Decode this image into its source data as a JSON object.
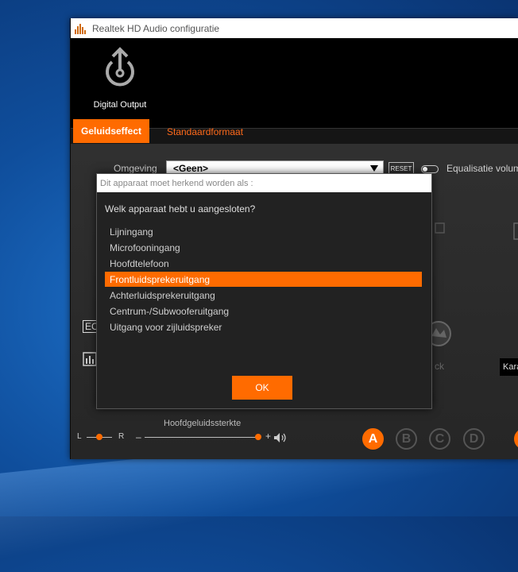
{
  "window": {
    "title": "Realtek HD Audio configuratie"
  },
  "device": {
    "label": "Digital Output"
  },
  "tabs": [
    {
      "label": "Geluidseffect"
    },
    {
      "label": "Standaardformaat"
    }
  ],
  "environment": {
    "label": "Omgeving",
    "value": "<Geen>"
  },
  "reset_label": "RESET",
  "equalizer_label": "Equalisatie volum",
  "bg": {
    "side_label": "EC",
    "kara_label": "Kara",
    "ck_label": "ck",
    "volume_label": "Hoofdgeluidssterkte",
    "balance_l": "L",
    "balance_r": "R",
    "minus": "–",
    "plus": "+"
  },
  "channels": [
    "A",
    "B",
    "C",
    "D"
  ],
  "dialog": {
    "title": "Dit apparaat moet herkend worden als :",
    "question": "Welk apparaat hebt u aangesloten?",
    "options": [
      {
        "label": "Lijningang"
      },
      {
        "label": "Microfooningang"
      },
      {
        "label": "Hoofdtelefoon"
      },
      {
        "label": "Frontluidsprekeruitgang"
      },
      {
        "label": "Achterluidsprekeruitgang"
      },
      {
        "label": "Centrum-/Subwooferuitgang"
      },
      {
        "label": "Uitgang voor zijluidspreker"
      }
    ],
    "selected_index": 3,
    "ok_label": "OK"
  },
  "colors": {
    "accent": "#ff6b00",
    "window_bg": "#2c2c2c",
    "topbar": "#000000"
  }
}
